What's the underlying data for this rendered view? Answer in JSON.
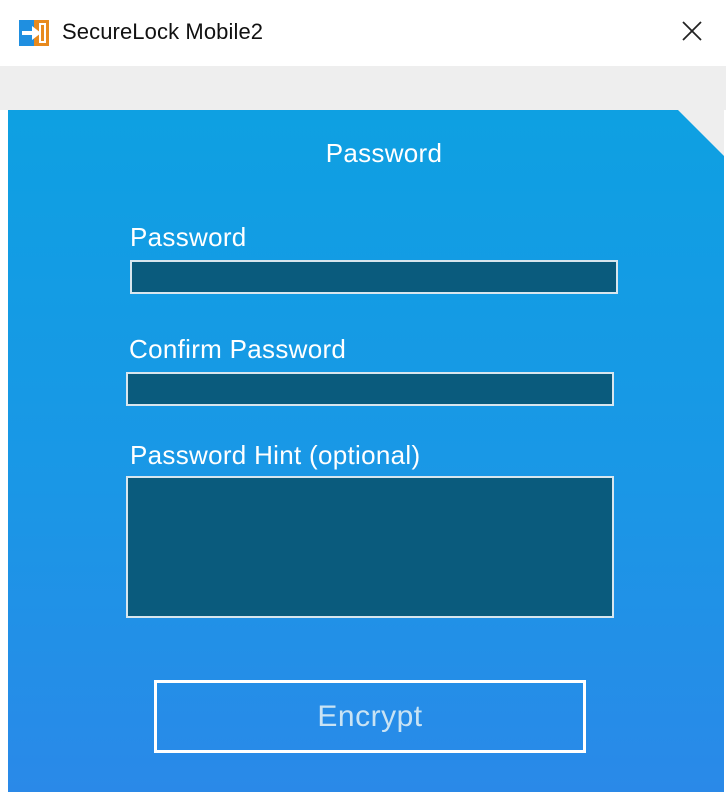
{
  "window": {
    "title": "SecureLock Mobile2",
    "app_icon": "securelock-app-icon",
    "close_icon": "close-icon",
    "close_glyph": "✕"
  },
  "panel": {
    "header": "Password",
    "background_color": "#1a97e6",
    "field_color": "#0a5b7d"
  },
  "form": {
    "password_label": "Password",
    "password_value": "",
    "confirm_label": "Confirm Password",
    "confirm_value": "",
    "hint_label": "Password Hint (optional)",
    "hint_value": "",
    "encrypt_label": "Encrypt"
  }
}
